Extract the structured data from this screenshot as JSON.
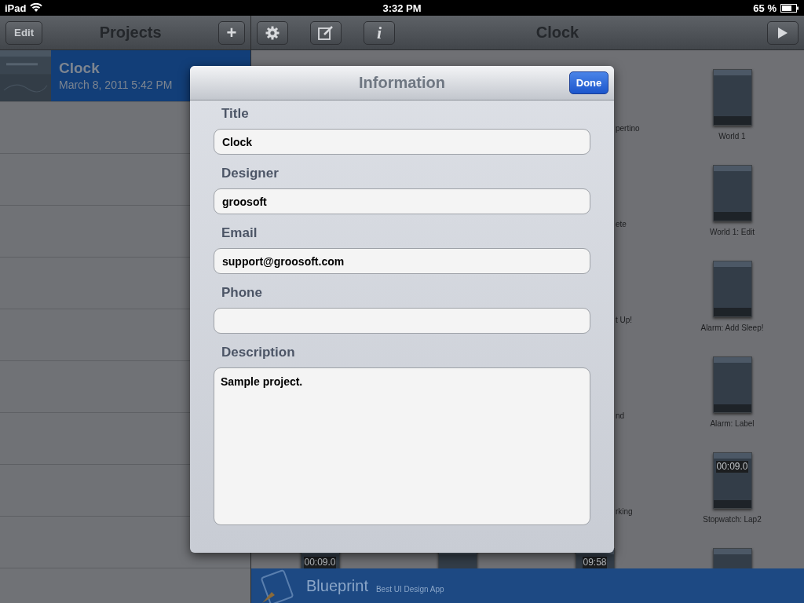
{
  "status_bar": {
    "device": "iPad",
    "time": "3:32 PM",
    "battery": "65 %"
  },
  "sidebar": {
    "edit_button": "Edit",
    "title": "Projects",
    "add_button": "+",
    "projects": [
      {
        "name": "Clock",
        "date": "March 8, 2011 5:42 PM",
        "selected": true
      }
    ]
  },
  "toolbar": {
    "info_button": "i",
    "title": "Clock"
  },
  "partial_labels": [
    "pertino",
    "ete",
    "t Up!",
    "nd",
    "rking"
  ],
  "screens": [
    {
      "kind": "thumbnail",
      "label": "World 1"
    },
    {
      "kind": "thumbnail",
      "label": "World 1: Edit"
    },
    {
      "kind": "thumbnail",
      "label": "Alarm: Add Sleep!"
    },
    {
      "kind": "thumbnail",
      "label": "Alarm: Label"
    },
    {
      "kind": "thumbnail",
      "label": "Stopwatch: Lap2",
      "readout": "00:09.0"
    },
    {
      "kind": "thumbnail"
    }
  ],
  "bottom_row": [
    {
      "kind": "thumbnail",
      "readout": "00:09.0"
    },
    {
      "kind": "thumbnail"
    },
    {
      "kind": "thumbnail",
      "readout": "09:58"
    }
  ],
  "banner": {
    "name": "Blueprint",
    "tagline": "Best UI Design App"
  },
  "dialog": {
    "title": "Information",
    "done_button": "Done",
    "fields": [
      {
        "label": "Title",
        "value": "Clock",
        "kind": "line"
      },
      {
        "label": "Designer",
        "value": "groosoft",
        "kind": "line"
      },
      {
        "label": "Email",
        "value": "support@groosoft.com",
        "kind": "line"
      },
      {
        "label": "Phone",
        "kind": "line"
      },
      {
        "label": "Description",
        "value": "Sample project.",
        "kind": "area"
      }
    ]
  }
}
